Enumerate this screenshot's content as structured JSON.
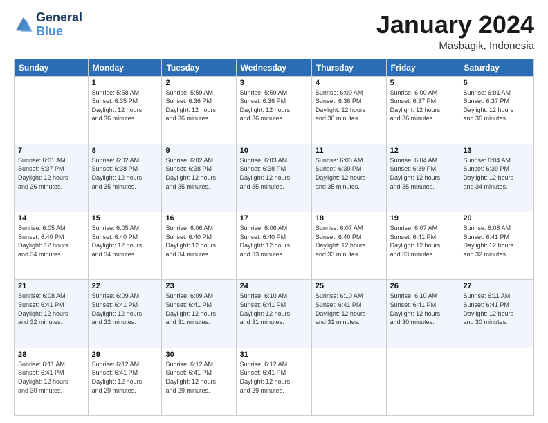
{
  "header": {
    "logo_line1": "General",
    "logo_line2": "Blue",
    "month_title": "January 2024",
    "location": "Masbagik, Indonesia"
  },
  "days_of_week": [
    "Sunday",
    "Monday",
    "Tuesday",
    "Wednesday",
    "Thursday",
    "Friday",
    "Saturday"
  ],
  "weeks": [
    [
      {
        "day": "",
        "sunrise": "",
        "sunset": "",
        "daylight": ""
      },
      {
        "day": "1",
        "sunrise": "Sunrise: 5:58 AM",
        "sunset": "Sunset: 6:35 PM",
        "daylight": "Daylight: 12 hours and 36 minutes."
      },
      {
        "day": "2",
        "sunrise": "Sunrise: 5:59 AM",
        "sunset": "Sunset: 6:36 PM",
        "daylight": "Daylight: 12 hours and 36 minutes."
      },
      {
        "day": "3",
        "sunrise": "Sunrise: 5:59 AM",
        "sunset": "Sunset: 6:36 PM",
        "daylight": "Daylight: 12 hours and 36 minutes."
      },
      {
        "day": "4",
        "sunrise": "Sunrise: 6:00 AM",
        "sunset": "Sunset: 6:36 PM",
        "daylight": "Daylight: 12 hours and 36 minutes."
      },
      {
        "day": "5",
        "sunrise": "Sunrise: 6:00 AM",
        "sunset": "Sunset: 6:37 PM",
        "daylight": "Daylight: 12 hours and 36 minutes."
      },
      {
        "day": "6",
        "sunrise": "Sunrise: 6:01 AM",
        "sunset": "Sunset: 6:37 PM",
        "daylight": "Daylight: 12 hours and 36 minutes."
      }
    ],
    [
      {
        "day": "7",
        "sunrise": "Sunrise: 6:01 AM",
        "sunset": "Sunset: 6:37 PM",
        "daylight": "Daylight: 12 hours and 36 minutes."
      },
      {
        "day": "8",
        "sunrise": "Sunrise: 6:02 AM",
        "sunset": "Sunset: 6:38 PM",
        "daylight": "Daylight: 12 hours and 35 minutes."
      },
      {
        "day": "9",
        "sunrise": "Sunrise: 6:02 AM",
        "sunset": "Sunset: 6:38 PM",
        "daylight": "Daylight: 12 hours and 35 minutes."
      },
      {
        "day": "10",
        "sunrise": "Sunrise: 6:03 AM",
        "sunset": "Sunset: 6:38 PM",
        "daylight": "Daylight: 12 hours and 35 minutes."
      },
      {
        "day": "11",
        "sunrise": "Sunrise: 6:03 AM",
        "sunset": "Sunset: 6:39 PM",
        "daylight": "Daylight: 12 hours and 35 minutes."
      },
      {
        "day": "12",
        "sunrise": "Sunrise: 6:04 AM",
        "sunset": "Sunset: 6:39 PM",
        "daylight": "Daylight: 12 hours and 35 minutes."
      },
      {
        "day": "13",
        "sunrise": "Sunrise: 6:04 AM",
        "sunset": "Sunset: 6:39 PM",
        "daylight": "Daylight: 12 hours and 34 minutes."
      }
    ],
    [
      {
        "day": "14",
        "sunrise": "Sunrise: 6:05 AM",
        "sunset": "Sunset: 6:40 PM",
        "daylight": "Daylight: 12 hours and 34 minutes."
      },
      {
        "day": "15",
        "sunrise": "Sunrise: 6:05 AM",
        "sunset": "Sunset: 6:40 PM",
        "daylight": "Daylight: 12 hours and 34 minutes."
      },
      {
        "day": "16",
        "sunrise": "Sunrise: 6:06 AM",
        "sunset": "Sunset: 6:40 PM",
        "daylight": "Daylight: 12 hours and 34 minutes."
      },
      {
        "day": "17",
        "sunrise": "Sunrise: 6:06 AM",
        "sunset": "Sunset: 6:40 PM",
        "daylight": "Daylight: 12 hours and 33 minutes."
      },
      {
        "day": "18",
        "sunrise": "Sunrise: 6:07 AM",
        "sunset": "Sunset: 6:40 PM",
        "daylight": "Daylight: 12 hours and 33 minutes."
      },
      {
        "day": "19",
        "sunrise": "Sunrise: 6:07 AM",
        "sunset": "Sunset: 6:41 PM",
        "daylight": "Daylight: 12 hours and 33 minutes."
      },
      {
        "day": "20",
        "sunrise": "Sunrise: 6:08 AM",
        "sunset": "Sunset: 6:41 PM",
        "daylight": "Daylight: 12 hours and 32 minutes."
      }
    ],
    [
      {
        "day": "21",
        "sunrise": "Sunrise: 6:08 AM",
        "sunset": "Sunset: 6:41 PM",
        "daylight": "Daylight: 12 hours and 32 minutes."
      },
      {
        "day": "22",
        "sunrise": "Sunrise: 6:09 AM",
        "sunset": "Sunset: 6:41 PM",
        "daylight": "Daylight: 12 hours and 32 minutes."
      },
      {
        "day": "23",
        "sunrise": "Sunrise: 6:09 AM",
        "sunset": "Sunset: 6:41 PM",
        "daylight": "Daylight: 12 hours and 31 minutes."
      },
      {
        "day": "24",
        "sunrise": "Sunrise: 6:10 AM",
        "sunset": "Sunset: 6:41 PM",
        "daylight": "Daylight: 12 hours and 31 minutes."
      },
      {
        "day": "25",
        "sunrise": "Sunrise: 6:10 AM",
        "sunset": "Sunset: 6:41 PM",
        "daylight": "Daylight: 12 hours and 31 minutes."
      },
      {
        "day": "26",
        "sunrise": "Sunrise: 6:10 AM",
        "sunset": "Sunset: 6:41 PM",
        "daylight": "Daylight: 12 hours and 30 minutes."
      },
      {
        "day": "27",
        "sunrise": "Sunrise: 6:11 AM",
        "sunset": "Sunset: 6:41 PM",
        "daylight": "Daylight: 12 hours and 30 minutes."
      }
    ],
    [
      {
        "day": "28",
        "sunrise": "Sunrise: 6:11 AM",
        "sunset": "Sunset: 6:41 PM",
        "daylight": "Daylight: 12 hours and 30 minutes."
      },
      {
        "day": "29",
        "sunrise": "Sunrise: 6:12 AM",
        "sunset": "Sunset: 6:41 PM",
        "daylight": "Daylight: 12 hours and 29 minutes."
      },
      {
        "day": "30",
        "sunrise": "Sunrise: 6:12 AM",
        "sunset": "Sunset: 6:41 PM",
        "daylight": "Daylight: 12 hours and 29 minutes."
      },
      {
        "day": "31",
        "sunrise": "Sunrise: 6:12 AM",
        "sunset": "Sunset: 6:41 PM",
        "daylight": "Daylight: 12 hours and 29 minutes."
      },
      {
        "day": "",
        "sunrise": "",
        "sunset": "",
        "daylight": ""
      },
      {
        "day": "",
        "sunrise": "",
        "sunset": "",
        "daylight": ""
      },
      {
        "day": "",
        "sunrise": "",
        "sunset": "",
        "daylight": ""
      }
    ]
  ]
}
